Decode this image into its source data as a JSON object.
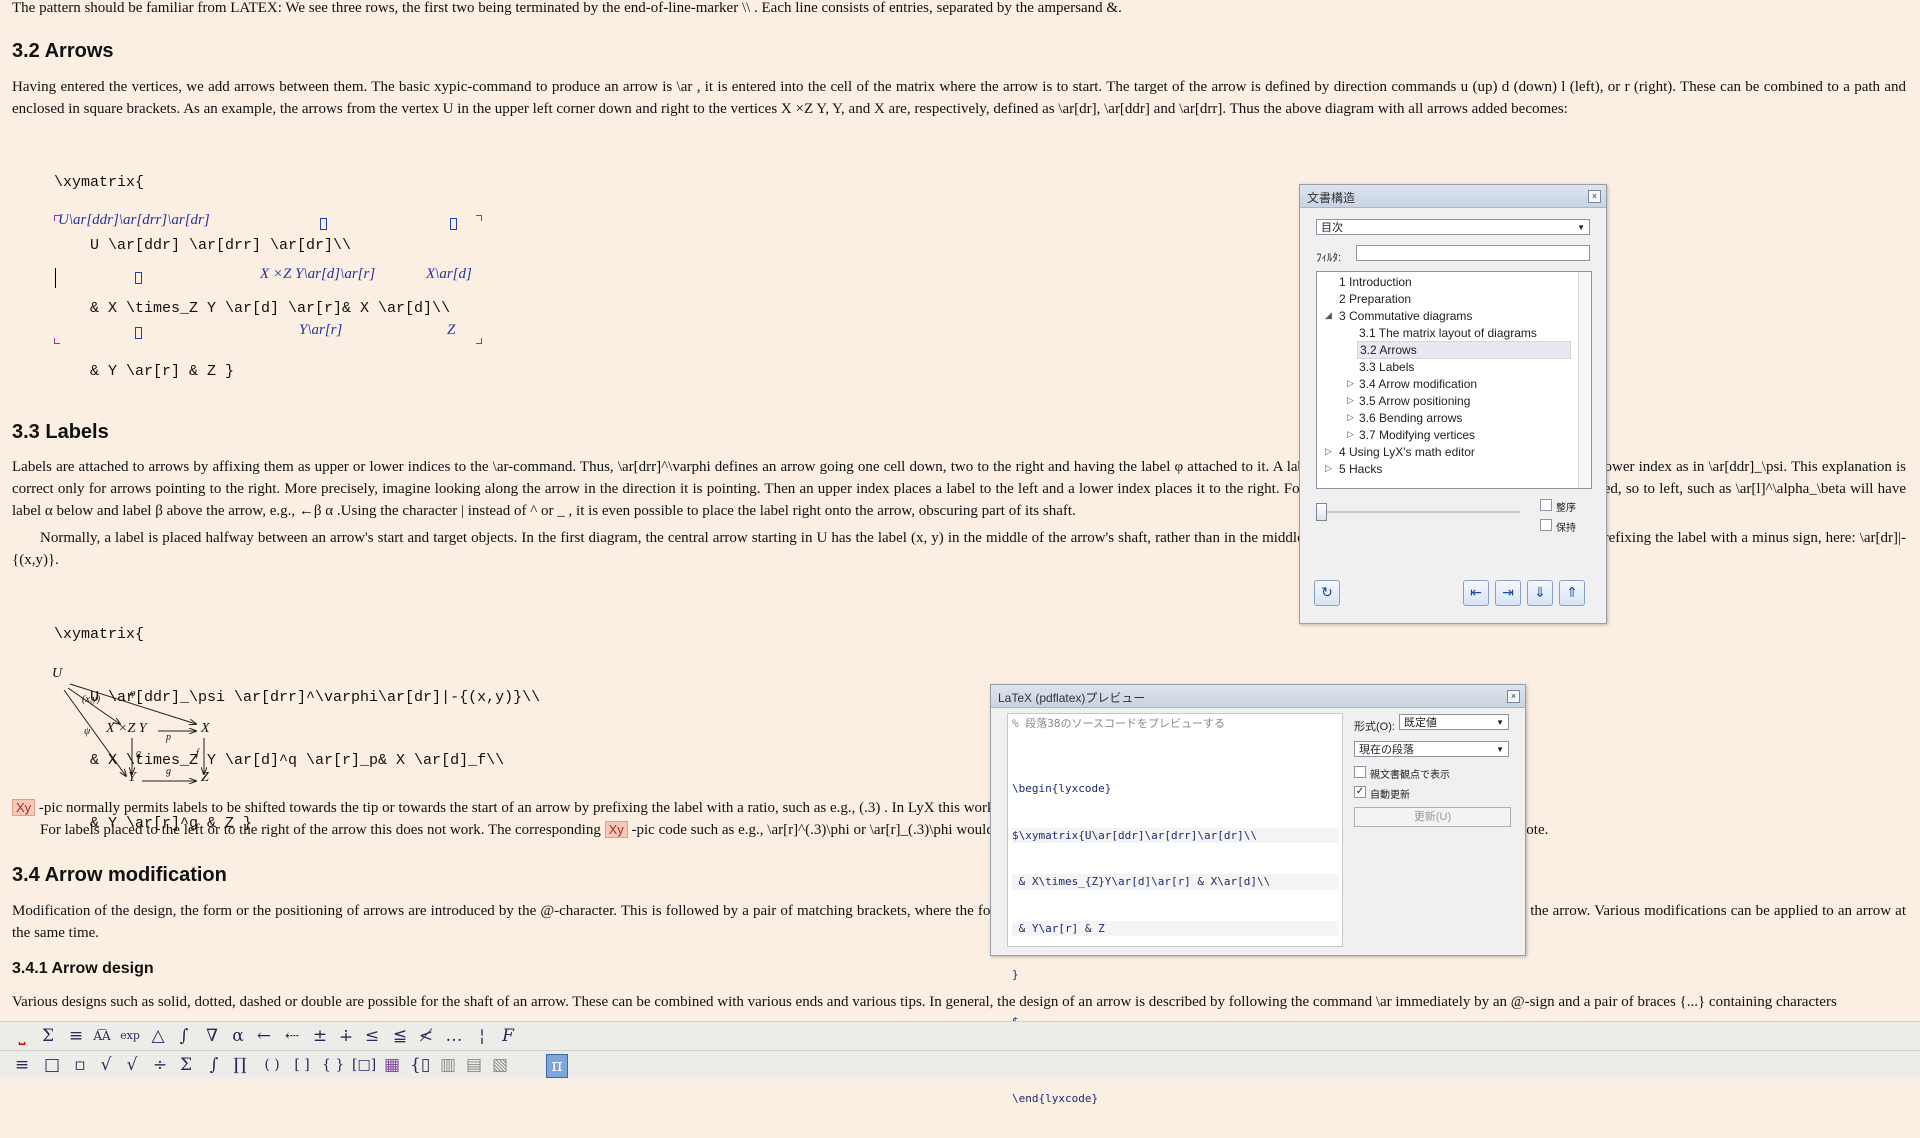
{
  "doc": {
    "intro_line": "The pattern should be familiar from LATEX: We see three rows, the first two being terminated by the end-of-line-marker \\\\ . Each line consists of entries, separated by the ampersand &.",
    "sec32_title": "3.2  Arrows",
    "sec32_p1": "Having entered the vertices, we add arrows between them. The basic xypic-command to produce an arrow is \\ar , it is entered into the cell of the matrix where the arrow is to start. The target of the arrow is defined by direction commands u (up) d (down) l (left), or r (right). These can be combined to a path and enclosed in square brackets. As an example, the arrows from the vertex U in the upper left corner down and right to the vertices X ×Z Y, Y, and X are, respectively, defined as \\ar[dr], \\ar[ddr] and \\ar[drr]. Thus the above diagram with all arrows added becomes:",
    "code1": [
      "\\xymatrix{",
      "    U \\ar[ddr] \\ar[drr] \\ar[dr]\\\\",
      "    & X \\times_Z Y \\ar[d] \\ar[r]& X \\ar[d]\\\\",
      "    & Y \\ar[r] & Z }"
    ],
    "matrix": {
      "r1c1": "U\\ar[ddr]\\ar[drr]\\ar[dr]",
      "r2c2": "X ×Z Y\\ar[d]\\ar[r]",
      "r2c3": "X\\ar[d]",
      "r3c2": "Y\\ar[r]",
      "r3c3": "Z"
    },
    "sec33_title": "3.3  Labels",
    "sec33_p1": "Labels are attached to arrows by affixing them as upper or lower indices to the \\ar-command. Thus, \\ar[drr]^\\varphi defines an arrow going one cell down, two to the right and having the label φ attached to it. A label can be placed below the arrow by making it a lower index as in \\ar[ddr]_\\psi. This explanation is correct only for arrows pointing to the right. More precisely, imagine looking along the arrow in the direction it is pointing. Then an upper index places a label to the left and a lower index places it to the right. For arrows pointing to the left, the meaning is reversed, so to left, such as \\ar[l]^\\alpha_\\beta will have label α below and label β above the arrow, e.g., ←β α .Using the character | instead of ^ or _ , it is even possible to place the label right onto the arrow, obscuring part of its shaft.",
    "sec33_p2": "Normally, a label is placed halfway between an arrow's start and target objects. In the first diagram, the central arrow starting in U has the label (x, y) in the middle of the arrow's shaft, rather than in the middle between its endpoints. This can be achieved by prefixing the label with a minus sign, here: \\ar[dr]|-{(x,y)}.",
    "code2": [
      "\\xymatrix{",
      "    U \\ar[ddr]_\\psi \\ar[drr]^\\varphi\\ar[dr]|-{(x,y)}\\\\",
      "    & X \\times_Z Y \\ar[d]^q \\ar[r]_p& X \\ar[d]_f\\\\",
      "    & Y \\ar[r]^g & Z }"
    ],
    "diagram": {
      "U": "U",
      "XZY": "X ×Z Y",
      "X": "X",
      "Y": "Y",
      "Z": "Z",
      "xy": "(x,y)",
      "phi": "φ",
      "psi": "ψ",
      "p": "p",
      "q": "q",
      "f": "f",
      "g": "g"
    },
    "para_xy1": "-pic normally permits labels to be shifted towards the tip or towards the start of an arrow by prefixing the label with a ratio, such as e.g., (.3) . In LyX this works only for labels placed onto the arrow, in the form of \\ar[r]|(.3)\\phi .",
    "para_xy2": "For labels placed to the left or to the right of the arrow this does not work. The corresponding",
    "para_xy2b": "-pic code such as e.g., \\ar[r]^(.3)\\phi or \\ar[r]_(.3)\\phi would have to be entered in ERT, one of the workarounds suggested in the last section of this note.",
    "inset_xy": "Xy",
    "sec34_title": "3.4  Arrow modification",
    "sec34_p1": "Modification of the design, the form or the positioning of arrows are introduced by the @-character. This is followed by a pair of matching brackets, where the form of the bracket determines the type of modification: the design, the or the curvature of the arrow. Various modifications can be applied to an arrow at the same time.",
    "sec341_title": "3.4.1  Arrow design",
    "sec341_p1": "Various designs such as solid, dotted, dashed or double are possible for the shaft of an arrow. These can be combined with various ends and various tips. In general, the design of an arrow is described by following the command \\ar immediately by an @-sign and a pair of braces {...} containing characters"
  },
  "outline_panel": {
    "title": "文書構造",
    "type_select": "目次",
    "filter_label": "ﾌｨﾙﾀ:",
    "filter_value": "",
    "items": [
      {
        "label": "1 Introduction"
      },
      {
        "label": "2 Preparation"
      },
      {
        "label": "3 Commutative diagrams"
      },
      {
        "label": "3.1 The matrix layout of diagrams"
      },
      {
        "label": "3.2 Arrows"
      },
      {
        "label": "3.3 Labels"
      },
      {
        "label": "3.4 Arrow modification"
      },
      {
        "label": "3.5 Arrow positioning"
      },
      {
        "label": "3.6 Bending arrows"
      },
      {
        "label": "3.7 Modifying vertices"
      },
      {
        "label": "4 Using LyX's math editor"
      },
      {
        "label": "5 Hacks"
      }
    ],
    "sort_label": "整序",
    "keep_label": "保持"
  },
  "preview_panel": {
    "title": "LaTeX (pdflatex)プレビュー",
    "comment": "% 段落38のソースコードをプレビューする",
    "code": [
      "\\begin{lyxcode}",
      "$\\xymatrix{U\\ar[ddr]\\ar[drr]\\ar[dr]\\\\",
      " & X\\times_{Z}Y\\ar[d]\\ar[r] & X\\ar[d]\\\\",
      " & Y\\ar[r] & Z",
      "}",
      "$",
      "",
      "\\end{lyxcode}"
    ],
    "format_label": "形式(O):",
    "format_value": "既定値",
    "scope_value": "現在の段落",
    "show_master_label": "親文書観点で表示",
    "auto_update_label": "自動更新",
    "update_button": "更新(U)"
  },
  "toolbar1": [
    "⎵",
    "Σ",
    "≡",
    "A͡A",
    "exp",
    "△",
    "∫",
    "∇",
    "α",
    "←",
    "⇠",
    "±",
    "∔",
    "≤",
    "≦",
    "≮",
    "…",
    "¦",
    "F"
  ],
  "toolbar2": [
    "≡",
    "□",
    "▫",
    "√",
    "√",
    "÷",
    "Σ",
    "∫",
    "∏",
    "( )",
    "[ ]",
    "{ }",
    "[□]",
    "▦",
    "{▯",
    "▥",
    "▤",
    "▧",
    "π"
  ]
}
